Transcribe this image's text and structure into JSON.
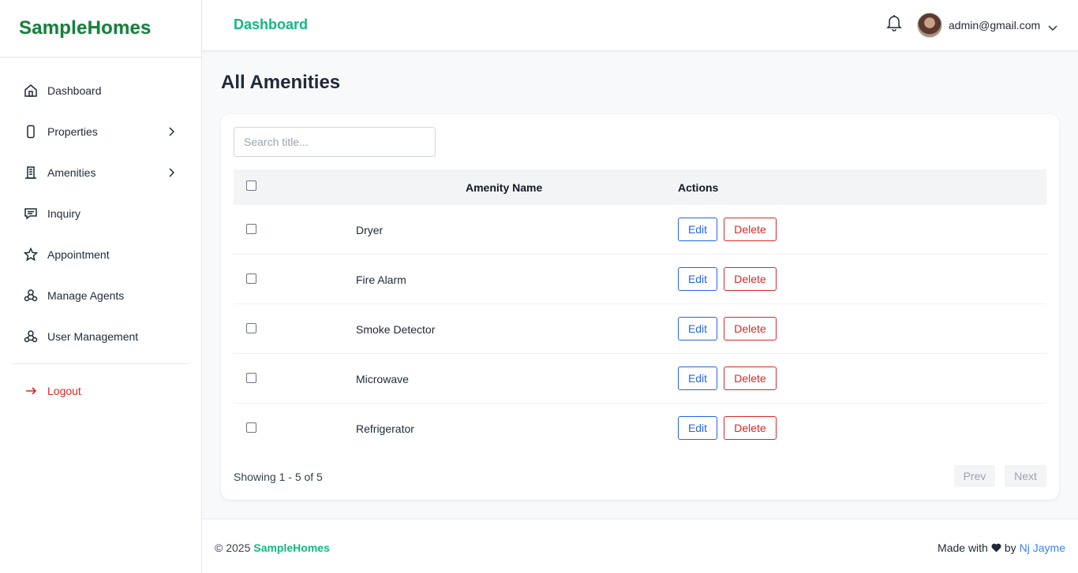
{
  "brand": "SampleHomes",
  "sidebar": {
    "items": [
      {
        "label": "Dashboard"
      },
      {
        "label": "Properties"
      },
      {
        "label": "Amenities"
      },
      {
        "label": "Inquiry"
      },
      {
        "label": "Appointment"
      },
      {
        "label": "Manage Agents"
      },
      {
        "label": "User Management"
      }
    ],
    "logout": "Logout"
  },
  "header": {
    "title": "Dashboard",
    "user_email": "admin@gmail.com"
  },
  "main": {
    "page_title": "All Amenities",
    "search_placeholder": "Search title...",
    "columns": {
      "name": "Amenity Name",
      "actions": "Actions"
    },
    "rows": [
      {
        "name": "Dryer"
      },
      {
        "name": "Fire Alarm"
      },
      {
        "name": "Smoke Detector"
      },
      {
        "name": "Microwave"
      },
      {
        "name": "Refrigerator"
      }
    ],
    "edit_label": "Edit",
    "delete_label": "Delete",
    "showing": "Showing 1 - 5 of 5",
    "prev_label": "Prev",
    "next_label": "Next"
  },
  "footer": {
    "copyright": "© 2025",
    "brand": "SampleHomes",
    "made_with": "Made with",
    "by": "by",
    "author": "Nj Jayme"
  },
  "colors": {
    "brand_green": "#15803d",
    "accent_green": "#10b981",
    "edit_blue": "#2563eb",
    "delete_red": "#dc2626",
    "link_blue": "#3b82f6"
  },
  "icons": {
    "sidebar": [
      "home-icon",
      "phone-icon",
      "building-icon",
      "chat-icon",
      "star-icon",
      "users-icon",
      "users-icon"
    ],
    "logout": "arrow-right-icon",
    "notifications": "bell-icon",
    "footer": "heart-icon"
  }
}
